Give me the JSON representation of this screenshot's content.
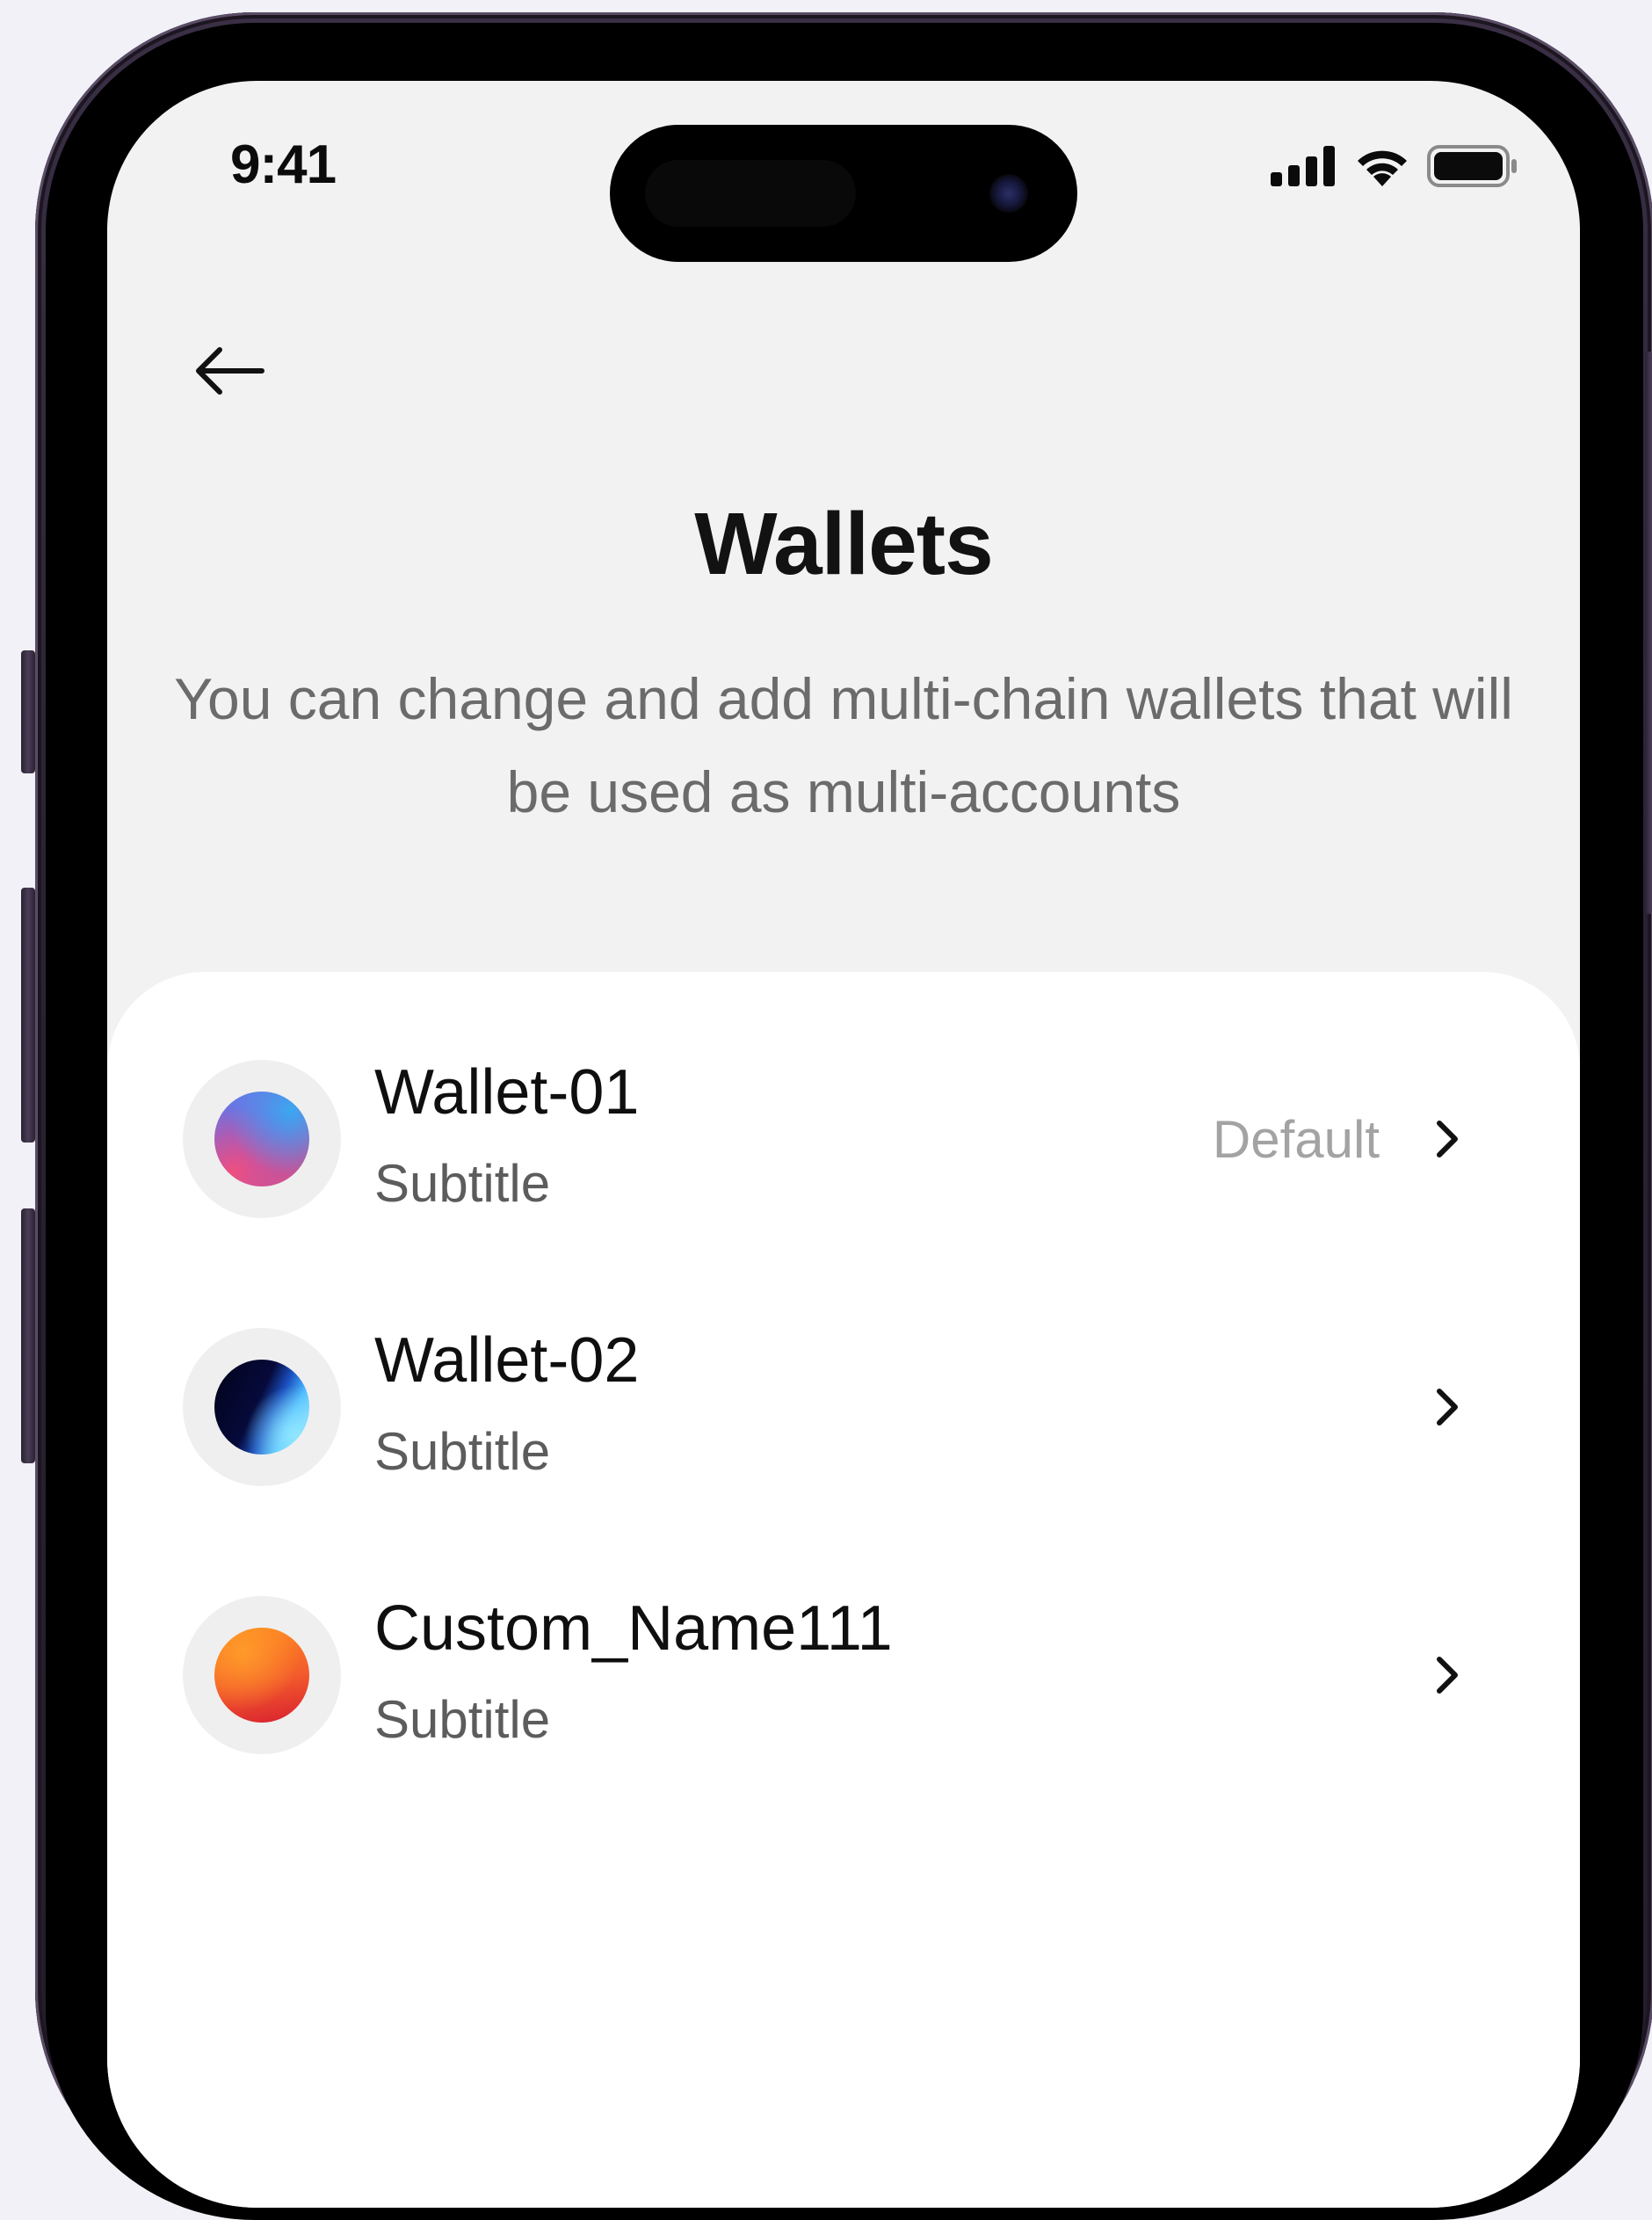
{
  "status_bar": {
    "time": "9:41",
    "icons": [
      "cellular-signal-icon",
      "wifi-icon",
      "battery-icon"
    ]
  },
  "header": {
    "back_icon": "arrow-left-icon",
    "title": "Wallets",
    "subtitle": "You can change and add multi-chain wallets that will be used as multi-accounts"
  },
  "wallets": [
    {
      "name": "Wallet-01",
      "subtitle": "Subtitle",
      "badge": "Default",
      "avatar": "gradient-blue-pink"
    },
    {
      "name": "Wallet-02",
      "subtitle": "Subtitle",
      "badge": "",
      "avatar": "gradient-navy-cyan"
    },
    {
      "name": "Custom_Name111",
      "subtitle": "Subtitle",
      "badge": "",
      "avatar": "gradient-orange-red"
    }
  ],
  "colors": {
    "page_background": "#f1f1f7",
    "screen_background": "#f2f2f2",
    "card_background": "#ffffff",
    "title_text": "#121212",
    "muted_text": "#6b6b6b",
    "badge_text": "#a3a3a3"
  }
}
